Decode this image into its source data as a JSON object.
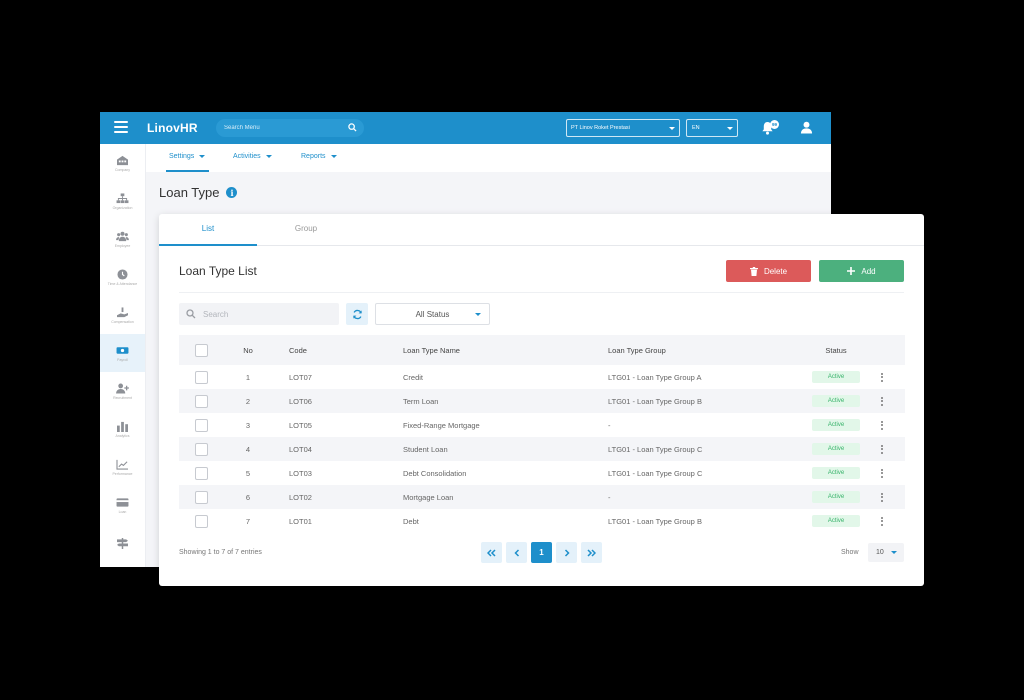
{
  "app": {
    "logo_prefix": "Linov",
    "logo_suffix": "HR",
    "search_menu_placeholder": "Search Menu",
    "company": "PT Linov Roket Prestasi",
    "language": "EN",
    "notification_count": "99"
  },
  "sidebar": {
    "items": [
      {
        "icon": "building-icon",
        "label": "Company"
      },
      {
        "icon": "org-chart-icon",
        "label": "Organization"
      },
      {
        "icon": "employees-icon",
        "label": "Employee"
      },
      {
        "icon": "clock-icon",
        "label": "Time & Attendance"
      },
      {
        "icon": "compensation-icon",
        "label": "Compensation"
      },
      {
        "icon": "money-icon",
        "label": "Payroll",
        "active": true
      },
      {
        "icon": "add-user-icon",
        "label": "Recruitment"
      },
      {
        "icon": "bar-chart-icon",
        "label": "Analytics"
      },
      {
        "icon": "trend-icon",
        "label": "Performance"
      },
      {
        "icon": "card-icon",
        "label": "Loan"
      },
      {
        "icon": "signpost-icon",
        "label": ""
      }
    ]
  },
  "subnav": {
    "settings": "Settings",
    "activities": "Activities",
    "reports": "Reports"
  },
  "page": {
    "title": "Loan Type"
  },
  "card": {
    "tabs": [
      "List",
      "Group"
    ],
    "list_title": "Loan Type List",
    "delete_label": "Delete",
    "add_label": "Add",
    "search_placeholder": "Search",
    "status_filter": "All Status"
  },
  "table": {
    "headers": {
      "no": "No",
      "code": "Code",
      "name": "Loan Type Name",
      "group": "Loan Type Group",
      "status": "Status"
    },
    "rows": [
      {
        "no": "1",
        "code": "LOT07",
        "name": "Credit",
        "group": "LTG01 - Loan Type Group A",
        "status": "Active"
      },
      {
        "no": "2",
        "code": "LOT06",
        "name": "Term Loan",
        "group": "LTG01 - Loan Type Group B",
        "status": "Active"
      },
      {
        "no": "3",
        "code": "LOT05",
        "name": "Fixed-Range Mortgage",
        "group": "-",
        "status": "Active"
      },
      {
        "no": "4",
        "code": "LOT04",
        "name": "Student Loan",
        "group": "LTG01 - Loan Type Group C",
        "status": "Active"
      },
      {
        "no": "5",
        "code": "LOT03",
        "name": "Debt Consolidation",
        "group": "LTG01 - Loan Type Group C",
        "status": "Active"
      },
      {
        "no": "6",
        "code": "LOT02",
        "name": "Mortgage Loan",
        "group": "-",
        "status": "Active"
      },
      {
        "no": "7",
        "code": "LOT01",
        "name": "Debt",
        "group": "LTG01 - Loan Type Group B",
        "status": "Active"
      }
    ]
  },
  "footer": {
    "showing": "Showing 1 to 7 of 7 entries",
    "current_page": "1",
    "show_label": "Show",
    "page_size": "10"
  },
  "colors": {
    "primary": "#1e8fcb",
    "delete": "#dc5a5a",
    "add": "#4cb07e",
    "active_badge_bg": "#e2f7e9",
    "active_badge_text": "#37b36a"
  }
}
